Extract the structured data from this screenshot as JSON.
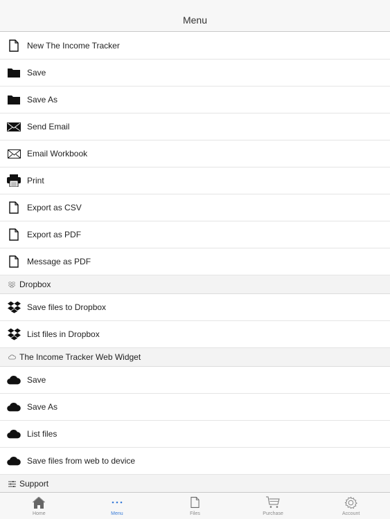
{
  "header": {
    "title": "Menu"
  },
  "menu_items": [
    {
      "label": "New The Income Tracker",
      "icon": "document-icon"
    },
    {
      "label": "Save",
      "icon": "folder-icon"
    },
    {
      "label": "Save As",
      "icon": "folder-icon"
    },
    {
      "label": "Send Email",
      "icon": "envelope-filled-icon"
    },
    {
      "label": "Email Workbook",
      "icon": "envelope-outline-icon"
    },
    {
      "label": "Print",
      "icon": "printer-icon"
    },
    {
      "label": "Export as CSV",
      "icon": "document-icon"
    },
    {
      "label": "Export as PDF",
      "icon": "document-icon"
    },
    {
      "label": "Message as PDF",
      "icon": "document-icon"
    }
  ],
  "dropbox_section": {
    "title": "Dropbox",
    "icon": "dropbox-outline-icon",
    "items": [
      {
        "label": "Save files to Dropbox",
        "icon": "dropbox-icon"
      },
      {
        "label": "List files in Dropbox",
        "icon": "dropbox-icon"
      }
    ]
  },
  "widget_section": {
    "title": "The Income Tracker Web Widget",
    "icon": "cloud-outline-icon",
    "items": [
      {
        "label": "Save",
        "icon": "cloud-icon"
      },
      {
        "label": "Save As",
        "icon": "cloud-icon"
      },
      {
        "label": "List files",
        "icon": "cloud-icon"
      },
      {
        "label": "Save files from web to device",
        "icon": "cloud-icon"
      }
    ]
  },
  "support_section": {
    "title": "Support",
    "icon": "sliders-icon"
  },
  "tabbar": {
    "active_color": "#3b7dd8",
    "tabs": [
      {
        "label": "Home",
        "icon": "home-icon",
        "active": false
      },
      {
        "label": "Menu",
        "icon": "more-dots-icon",
        "active": true
      },
      {
        "label": "Files",
        "icon": "document-icon",
        "active": false
      },
      {
        "label": "Purchase",
        "icon": "cart-icon",
        "active": false
      },
      {
        "label": "Account",
        "icon": "gear-icon",
        "active": false
      }
    ]
  }
}
